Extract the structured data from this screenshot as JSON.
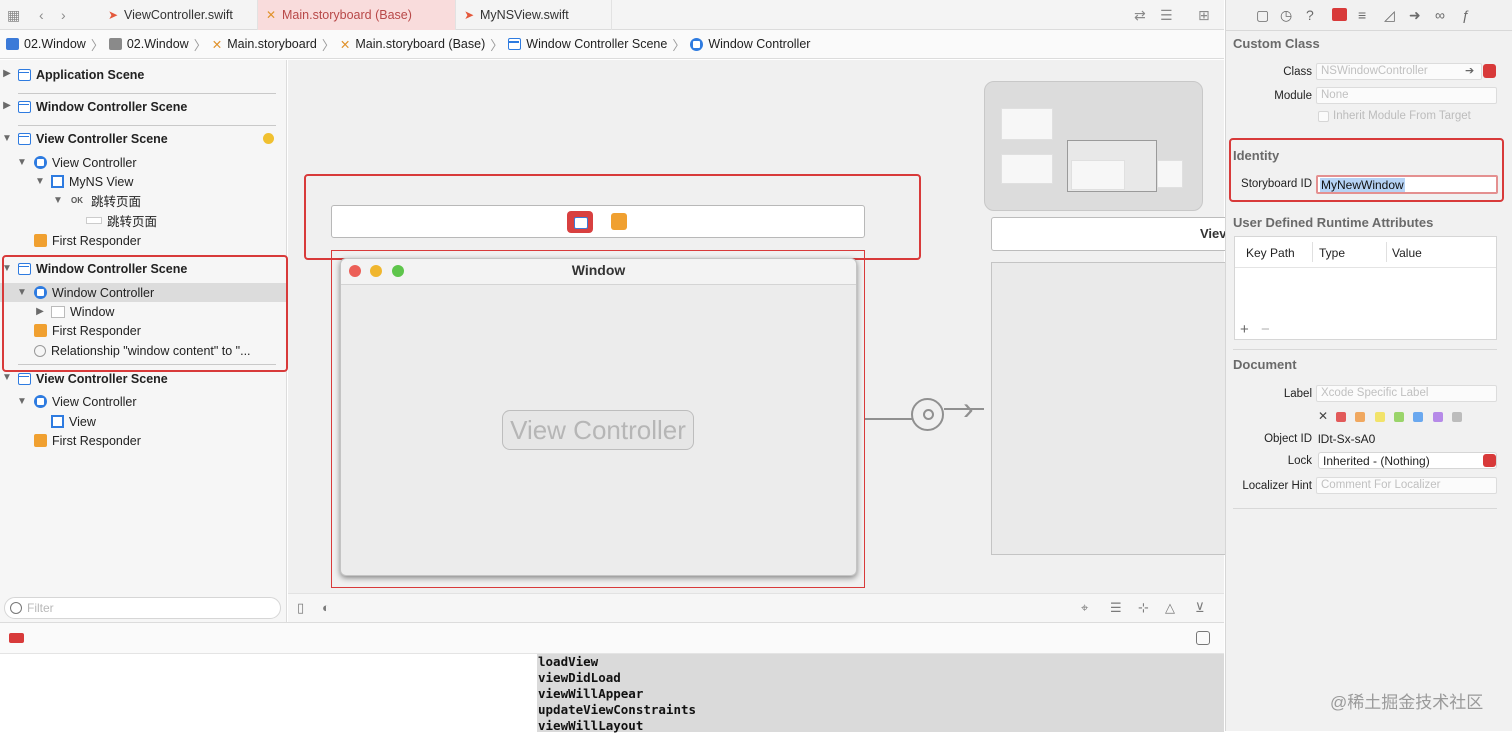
{
  "tabs": [
    {
      "label": "ViewController.swift"
    },
    {
      "label": "Main.storyboard (Base)"
    },
    {
      "label": "MyNSView.swift"
    }
  ],
  "breadcrumb": [
    "02.Window",
    "02.Window",
    "Main.storyboard",
    "Main.storyboard (Base)",
    "Window Controller Scene",
    "Window Controller"
  ],
  "navigator": {
    "items": [
      "Application Scene",
      "Window Controller Scene",
      "View Controller Scene",
      "View Controller",
      "MyNS View",
      "跳转页面",
      "跳转页面",
      "First Responder",
      "Window Controller Scene",
      "Window Controller",
      "Window",
      "First Responder",
      "Relationship \"window content\" to \"...",
      "View Controller Scene",
      "View Controller",
      "View",
      "First Responder"
    ],
    "ok_badge": "OK",
    "filter_placeholder": "Filter"
  },
  "canvas": {
    "window_title": "Window",
    "view_controller_label": "View Controller",
    "right_scene_label": "Viev"
  },
  "console": {
    "lines": [
      "loadView",
      "viewDidLoad",
      "viewWillAppear",
      "updateViewConstraints",
      "viewWillLayout"
    ]
  },
  "inspector": {
    "custom_class": {
      "header": "Custom Class",
      "class_label": "Class",
      "class_value": "NSWindowController",
      "module_label": "Module",
      "module_value": "None",
      "inherit_label": "Inherit Module From Target"
    },
    "identity": {
      "header": "Identity",
      "storyboard_id_label": "Storyboard ID",
      "storyboard_id_value": "MyNewWindow"
    },
    "runtime": {
      "header": "User Defined Runtime Attributes",
      "columns": [
        "Key Path",
        "Type",
        "Value"
      ]
    },
    "document": {
      "header": "Document",
      "label_label": "Label",
      "label_placeholder": "Xcode Specific Label",
      "object_id_label": "Object ID",
      "object_id_value": "lDt-Sx-sA0",
      "lock_label": "Lock",
      "lock_value": "Inherited - (Nothing)",
      "localizer_label": "Localizer Hint",
      "localizer_placeholder": "Comment For Localizer"
    },
    "swatches": [
      "#e25a5a",
      "#f0a860",
      "#f2e36a",
      "#9ad46a",
      "#6aa8ef",
      "#b68ae8",
      "#bcbcbc"
    ]
  },
  "watermark": "@稀土掘金技术社区"
}
